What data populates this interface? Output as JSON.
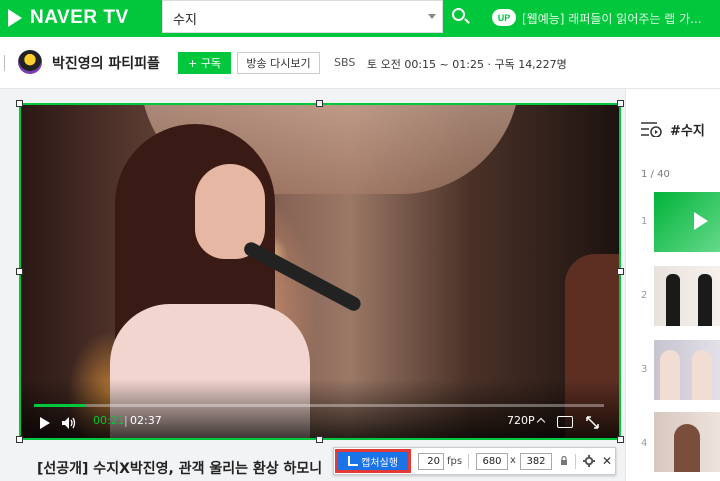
{
  "header": {
    "logo_text": "NAVER TV",
    "search_value": "수지",
    "up_badge": "UP",
    "ticker_text": "[웹예능] 래퍼들이 읽어주는 랩 가..."
  },
  "channel": {
    "name": "박진영의 파티피플",
    "subscribe_label": "+ 구독",
    "replay_label": "방송 다시보기",
    "broadcaster": "SBS",
    "schedule": "토 오전 00:15 ~ 01:25  ·  구독 14,227명"
  },
  "player": {
    "current_time": "00:21",
    "separator": "|",
    "duration": "02:37",
    "quality": "720P",
    "progress_fraction": 0.09
  },
  "video": {
    "title": "[선공개] 수지X박진영, 관객 울리는 환상 하모니"
  },
  "capture_toolbar": {
    "run_label": "캡처실행",
    "fps_value": "20",
    "fps_unit": "fps",
    "width_value": "680",
    "x_label": "x",
    "height_value": "382",
    "close_label": "✕"
  },
  "sidebar": {
    "tag": "#수지",
    "count": "1 / 40",
    "items": [
      {
        "num": "1"
      },
      {
        "num": "2"
      },
      {
        "num": "3"
      },
      {
        "num": "4"
      }
    ]
  },
  "colors": {
    "brand_green": "#00c73c",
    "capture_blue": "#1a73e8",
    "highlight_red": "#e53935"
  }
}
